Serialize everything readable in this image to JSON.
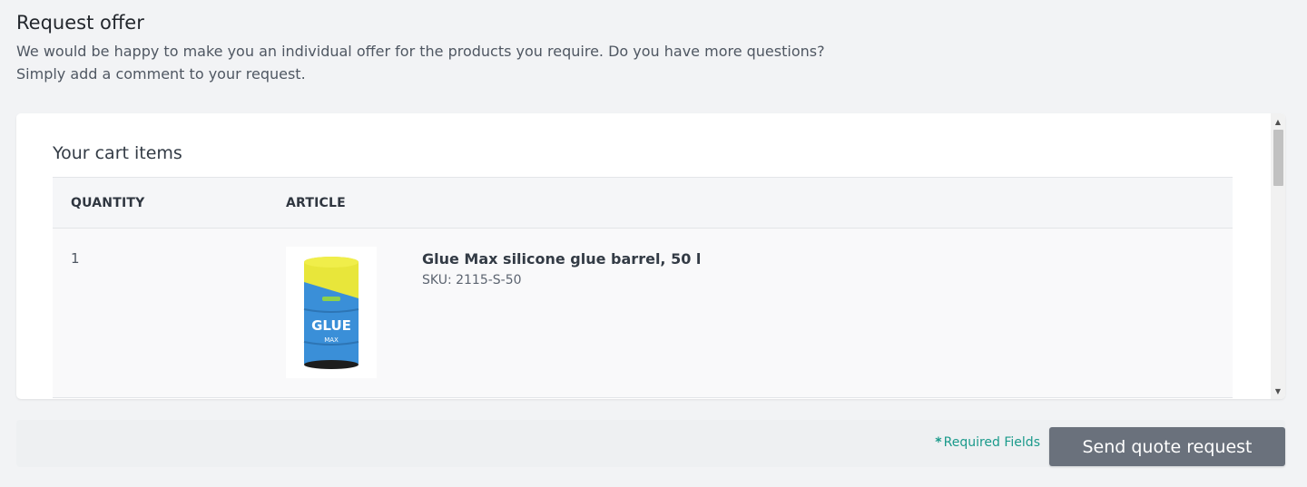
{
  "header": {
    "title": "Request offer",
    "description": "We would be happy to make you an individual offer for the products you require. Do you have more questions? Simply add a comment to your request."
  },
  "cart": {
    "title": "Your cart items",
    "columns": {
      "quantity": "QUANTITY",
      "article": "ARTICLE"
    },
    "items": [
      {
        "quantity": "1",
        "name": "Glue Max silicone glue barrel, 50 l",
        "sku": "SKU: 2115-S-50",
        "image_text": "GLUE",
        "image_subtext": "MAX"
      }
    ]
  },
  "footer": {
    "required_asterisk": "*",
    "required_label": "Required Fields",
    "send_button": "Send quote request"
  },
  "colors": {
    "accent_teal": "#1a9a8b",
    "button_gray": "#6a717c",
    "barrel_blue": "#3a8fd8",
    "barrel_yellow": "#e8e63a"
  }
}
